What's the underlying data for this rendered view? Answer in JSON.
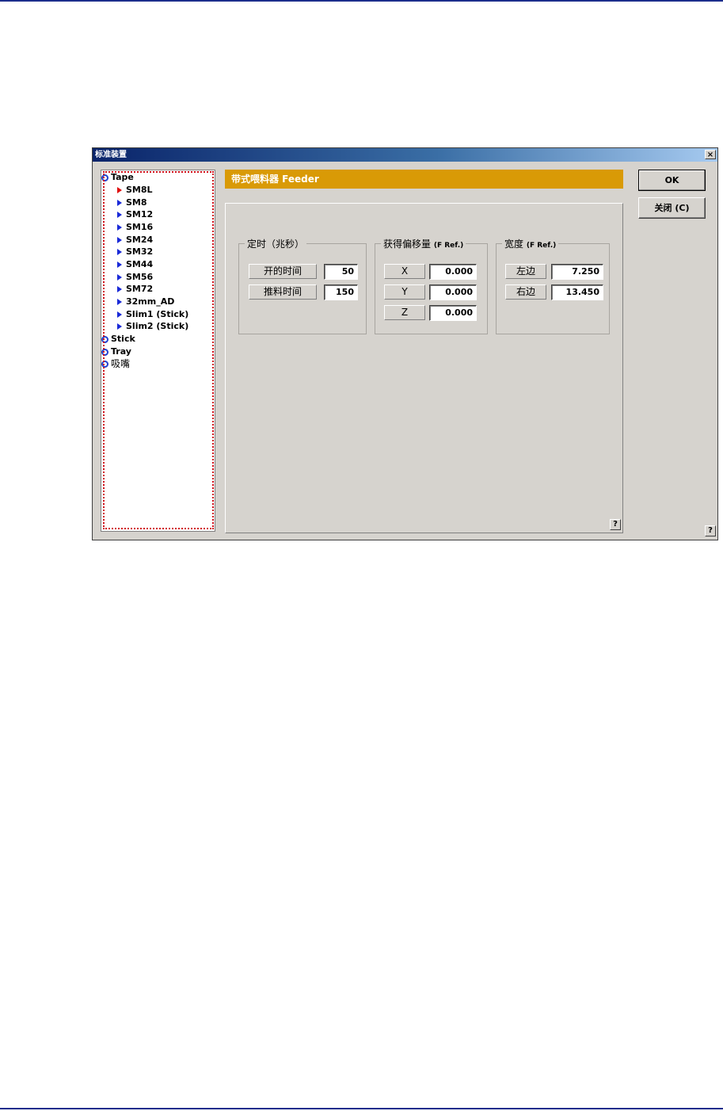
{
  "dialog": {
    "title": "标准装置",
    "close_glyph": "×",
    "header": "带式喂料器 Feeder",
    "buttons": {
      "ok": "OK",
      "close": "关闭 (C)"
    },
    "help_glyph": "?"
  },
  "tree": {
    "roots": [
      {
        "label": "Tape",
        "children": [
          "SM8L",
          "SM8",
          "SM12",
          "SM16",
          "SM24",
          "SM32",
          "SM44",
          "SM56",
          "SM72",
          "32mm_AD",
          "Slim1 (Stick)",
          "Slim2 (Stick)"
        ],
        "selected": "SM8L"
      },
      {
        "label": "Stick"
      },
      {
        "label": "Tray"
      },
      {
        "label": "吸嘴"
      }
    ]
  },
  "timing": {
    "title": "定时（兆秒）",
    "open_label": "开的时间",
    "open_value": "50",
    "push_label": "推料时间",
    "push_value": "150"
  },
  "offset": {
    "title": "获得偏移量",
    "title_ref": "(F Ref.)",
    "x_label": "X",
    "x_value": "0.000",
    "y_label": "Y",
    "y_value": "0.000",
    "z_label": "Z",
    "z_value": "0.000"
  },
  "width": {
    "title": "宽度",
    "title_ref": "(F Ref.)",
    "left_label": "左边",
    "left_value": "7.250",
    "right_label": "右边",
    "right_value": "13.450"
  },
  "colors": {
    "header_bg": "#d99a06",
    "titlebar_start": "#0a246a",
    "tree_arrow": "#1a2ad8",
    "selected_arrow": "#e01010",
    "focus_outline": "#d0101a"
  }
}
